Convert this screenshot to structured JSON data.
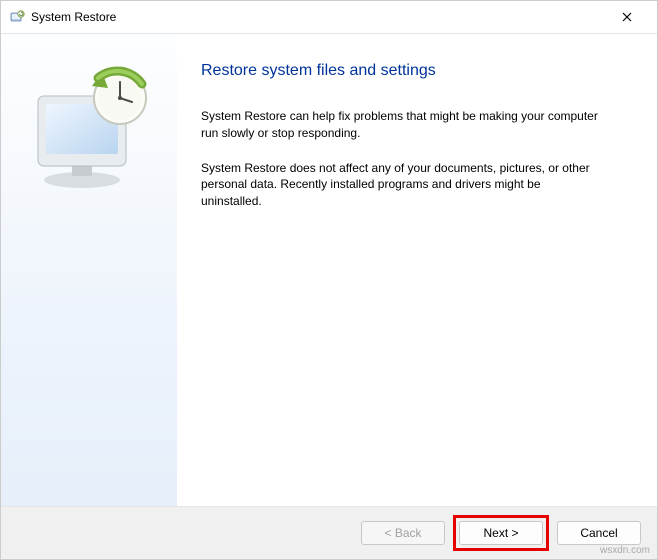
{
  "window": {
    "title": "System Restore"
  },
  "main": {
    "heading": "Restore system files and settings",
    "p1": "System Restore can help fix problems that might be making your computer run slowly or stop responding.",
    "p2": "System Restore does not affect any of your documents, pictures, or other personal data. Recently installed programs and drivers might be uninstalled."
  },
  "footer": {
    "back": "< Back",
    "next": "Next >",
    "cancel": "Cancel"
  },
  "watermark": "wsxdn.com"
}
